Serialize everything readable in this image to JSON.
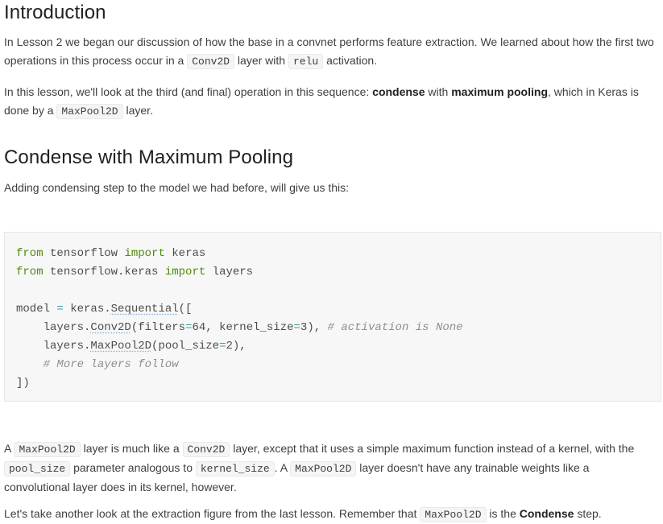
{
  "intro": {
    "heading": "Introduction",
    "p1": {
      "t1": "In Lesson 2 we began our discussion of how the base in a convnet performs feature extraction. We learned about how the first two operations in this process occur in a ",
      "code1": "Conv2D",
      "t2": " layer with ",
      "code2": "relu",
      "t3": " activation."
    },
    "p2": {
      "t1": "In this lesson, we'll look at the third (and final) operation in this sequence: ",
      "b1": "condense",
      "t2": " with ",
      "b2": "maximum pooling",
      "t3": ", which in Keras is done by a ",
      "code1": "MaxPool2D",
      "t4": " layer."
    }
  },
  "condense": {
    "heading": "Condense with Maximum Pooling",
    "p1": "Adding condensing step to the model we had before, will give us this:"
  },
  "code": {
    "l1": {
      "kw1": "from",
      "mod": " tensorflow ",
      "kw2": "import",
      "name": " keras"
    },
    "l2": {
      "kw1": "from",
      "mod": " tensorflow.keras ",
      "kw2": "import",
      "name": " layers"
    },
    "l4": {
      "a": "model ",
      "eq": "=",
      "b": " keras.",
      "fn": "Sequential",
      "c": "(["
    },
    "l5": {
      "indent": "    layers.",
      "fn": "Conv2D",
      "a": "(filters",
      "eq1": "=",
      "n1": "64",
      "b": ", kernel_size",
      "eq2": "=",
      "n2": "3",
      "c": "), ",
      "comment": "# activation is None"
    },
    "l6": {
      "indent": "    layers.",
      "fn": "MaxPool2D",
      "a": "(pool_size",
      "eq": "=",
      "n": "2",
      "b": "),"
    },
    "l7": {
      "indent": "    ",
      "comment": "# More layers follow"
    },
    "l8": "])"
  },
  "after": {
    "p1": {
      "t1": "A ",
      "code1": "MaxPool2D",
      "t2": " layer is much like a ",
      "code2": "Conv2D",
      "t3": " layer, except that it uses a simple maximum function instead of a kernel, with the ",
      "code3": "pool_size",
      "t4": " parameter analogous to ",
      "code4": "kernel_size",
      "t5": ". A ",
      "code5": "MaxPool2D",
      "t6": " layer doesn't have any trainable weights like a convolutional layer does in its kernel, however."
    },
    "p2": {
      "t1": "Let's take another look at the extraction figure from the last lesson. Remember that ",
      "code1": "MaxPool2D",
      "t2": " is the ",
      "b1": "Condense",
      "t3": " step."
    }
  }
}
